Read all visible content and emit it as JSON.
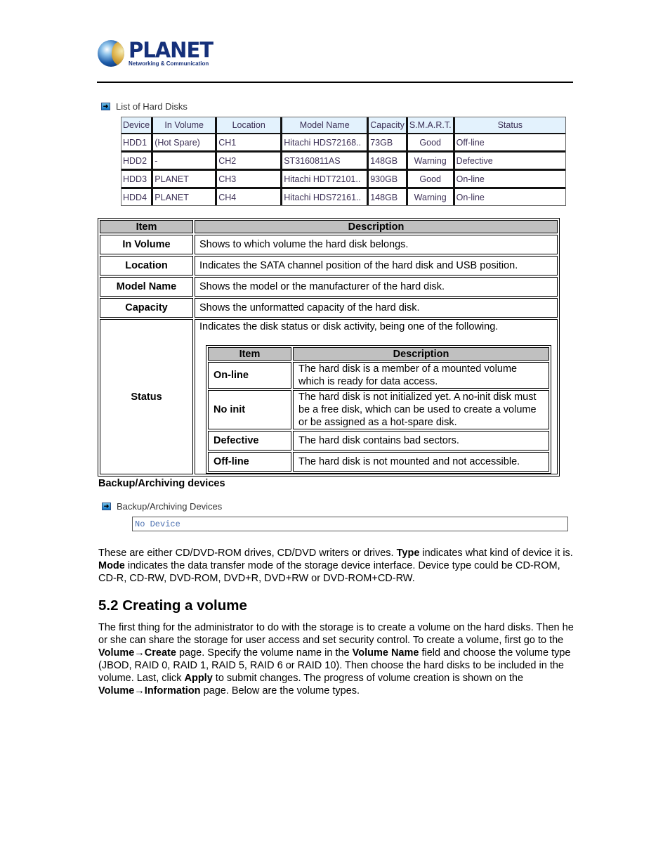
{
  "header": {
    "logo_name": "PLANET",
    "logo_tagline": "Networking & Communication"
  },
  "hard_disk_panel": {
    "caption": "List of Hard Disks",
    "icon": "arrow-right-icon",
    "columns": [
      "Device",
      "In Volume",
      "Location",
      "Model Name",
      "Capacity",
      "S.M.A.R.T.",
      "Status"
    ],
    "rows": [
      [
        "HDD1",
        "(Hot Spare)",
        "CH1",
        "Hitachi HDS72168..",
        "73GB",
        "Good",
        "Off-line"
      ],
      [
        "HDD2",
        "-",
        "CH2",
        "ST3160811AS",
        "148GB",
        "Warning",
        "Defective"
      ],
      [
        "HDD3",
        "PLANET",
        "CH3",
        "Hitachi HDT72101..",
        "930GB",
        "Good",
        "On-line"
      ],
      [
        "HDD4",
        "PLANET",
        "CH4",
        "Hitachi HDS72161..",
        "148GB",
        "Warning",
        "On-line"
      ]
    ]
  },
  "description_table": {
    "headers": [
      "Item",
      "Description"
    ],
    "rows": [
      {
        "item": "In Volume",
        "description": "Shows to which volume the hard disk belongs."
      },
      {
        "item": "Location",
        "description": "Indicates the SATA channel position of the hard disk and USB position."
      },
      {
        "item": "Model Name",
        "description": "Shows the model or the manufacturer of the hard disk."
      },
      {
        "item": "Capacity",
        "description": "Shows the unformatted capacity of the hard disk."
      }
    ],
    "status": {
      "item": "Status",
      "intro": "Indicates the disk status or disk activity, being one of the following.",
      "headers": [
        "Item",
        "Description"
      ],
      "rows": [
        {
          "item": "On-line",
          "description": "The hard disk is a member of a mounted volume which is ready for data access."
        },
        {
          "item": "No init",
          "description": "The hard disk is not initialized yet. A no-init disk must be a free disk, which can be used to create a volume or be assigned as a hot-spare disk."
        },
        {
          "item": "Defective",
          "description": "The hard disk contains bad sectors."
        },
        {
          "item": "Off-line",
          "description": "The hard disk is not mounted and not accessible."
        }
      ]
    }
  },
  "backup": {
    "heading": "Backup/Archiving devices",
    "caption": "Backup/Archiving Devices",
    "box_text": "No Device",
    "para": {
      "t1": "These are either CD/DVD-ROM drives, CD/DVD writers or drives. ",
      "b1": "Type",
      "t2": " indicates what kind of device it is. ",
      "b2": "Mode",
      "t3": " indicates the data transfer mode of the storage device interface. Device type could be CD-ROM, CD-R, CD-RW, DVD-ROM, DVD+R, DVD+RW or DVD-ROM+CD-RW."
    }
  },
  "section": {
    "title": "5.2 Creating a volume",
    "para": {
      "t1": "The first thing for the administrator to do with the storage is to create a volume on the hard disks. Then he or she can share the storage for user access and set security control. To create a volume, first go to the ",
      "b1": "Volume→Create",
      "t2": " page. Specify the volume name in the ",
      "b2": "Volume Name",
      "t3": " field and choose the volume type (JBOD, RAID 0, RAID 1, RAID 5, RAID 6 or RAID 10). Then choose the hard disks to be included in the volume. Last, click ",
      "b3": "Apply",
      "t4": " to submit changes. The progress of volume creation is shown on the ",
      "b4": "Volume→Information",
      "t5": " page. Below are the volume types."
    }
  }
}
